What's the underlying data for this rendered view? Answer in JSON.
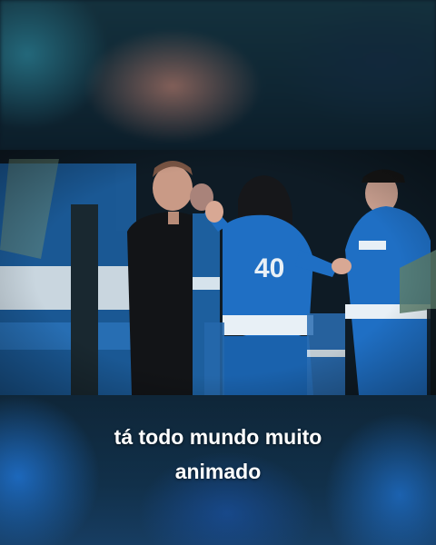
{
  "caption": {
    "line1": "tá todo mundo muito",
    "line2": "animado"
  },
  "jersey_text": "40",
  "colors": {
    "jersey_blue": "#1f6fc4",
    "jersey_stripe": "#e8f0f6",
    "background_dark": "#0d1a24",
    "caption_text": "#ffffff"
  }
}
